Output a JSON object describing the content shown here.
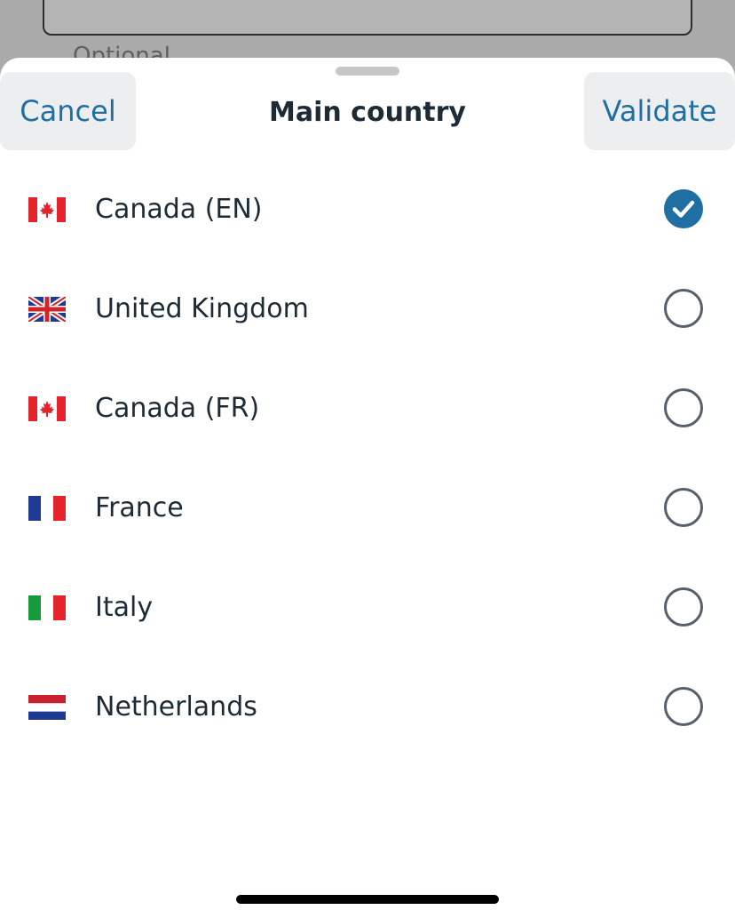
{
  "background": {
    "field_hint": "Optional"
  },
  "sheet": {
    "title": "Main country",
    "cancel_label": "Cancel",
    "validate_label": "Validate"
  },
  "countries": [
    {
      "label": "Canada (EN)",
      "flag": "canada-flag-icon",
      "selected": true
    },
    {
      "label": "United Kingdom",
      "flag": "uk-flag-icon",
      "selected": false
    },
    {
      "label": "Canada (FR)",
      "flag": "canada-flag-icon",
      "selected": false
    },
    {
      "label": "France",
      "flag": "france-flag-icon",
      "selected": false
    },
    {
      "label": "Italy",
      "flag": "italy-flag-icon",
      "selected": false
    },
    {
      "label": "Netherlands",
      "flag": "netherlands-flag-icon",
      "selected": false
    }
  ],
  "colors": {
    "accent": "#1f6fa3",
    "text": "#1d2b36",
    "button_bg": "#edeef0"
  }
}
